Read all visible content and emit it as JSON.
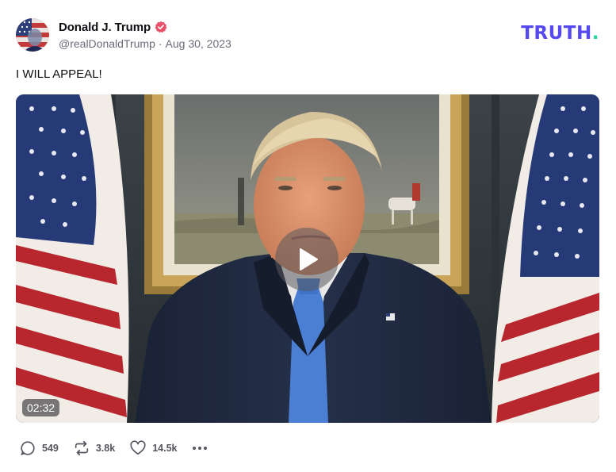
{
  "author": {
    "display_name": "Donald J. Trump",
    "handle": "@realDonaldTrump",
    "date": "Aug 30, 2023",
    "verified": true
  },
  "brand": {
    "name": "TRUTH",
    "suffix": "."
  },
  "post": {
    "text": "I WILL APPEAL!"
  },
  "video": {
    "duration": "02:32"
  },
  "actions": {
    "replies": "549",
    "retruths": "3.8k",
    "likes": "14.5k"
  },
  "icons": [
    "avatar",
    "verified-badge-icon",
    "play-icon",
    "reply-icon",
    "retruth-icon",
    "like-icon",
    "more-icon"
  ],
  "colors": {
    "brand": "#5448ee",
    "brand_dot": "#1fd8a4",
    "verified": "#e8506a",
    "muted": "#6b6b78"
  }
}
